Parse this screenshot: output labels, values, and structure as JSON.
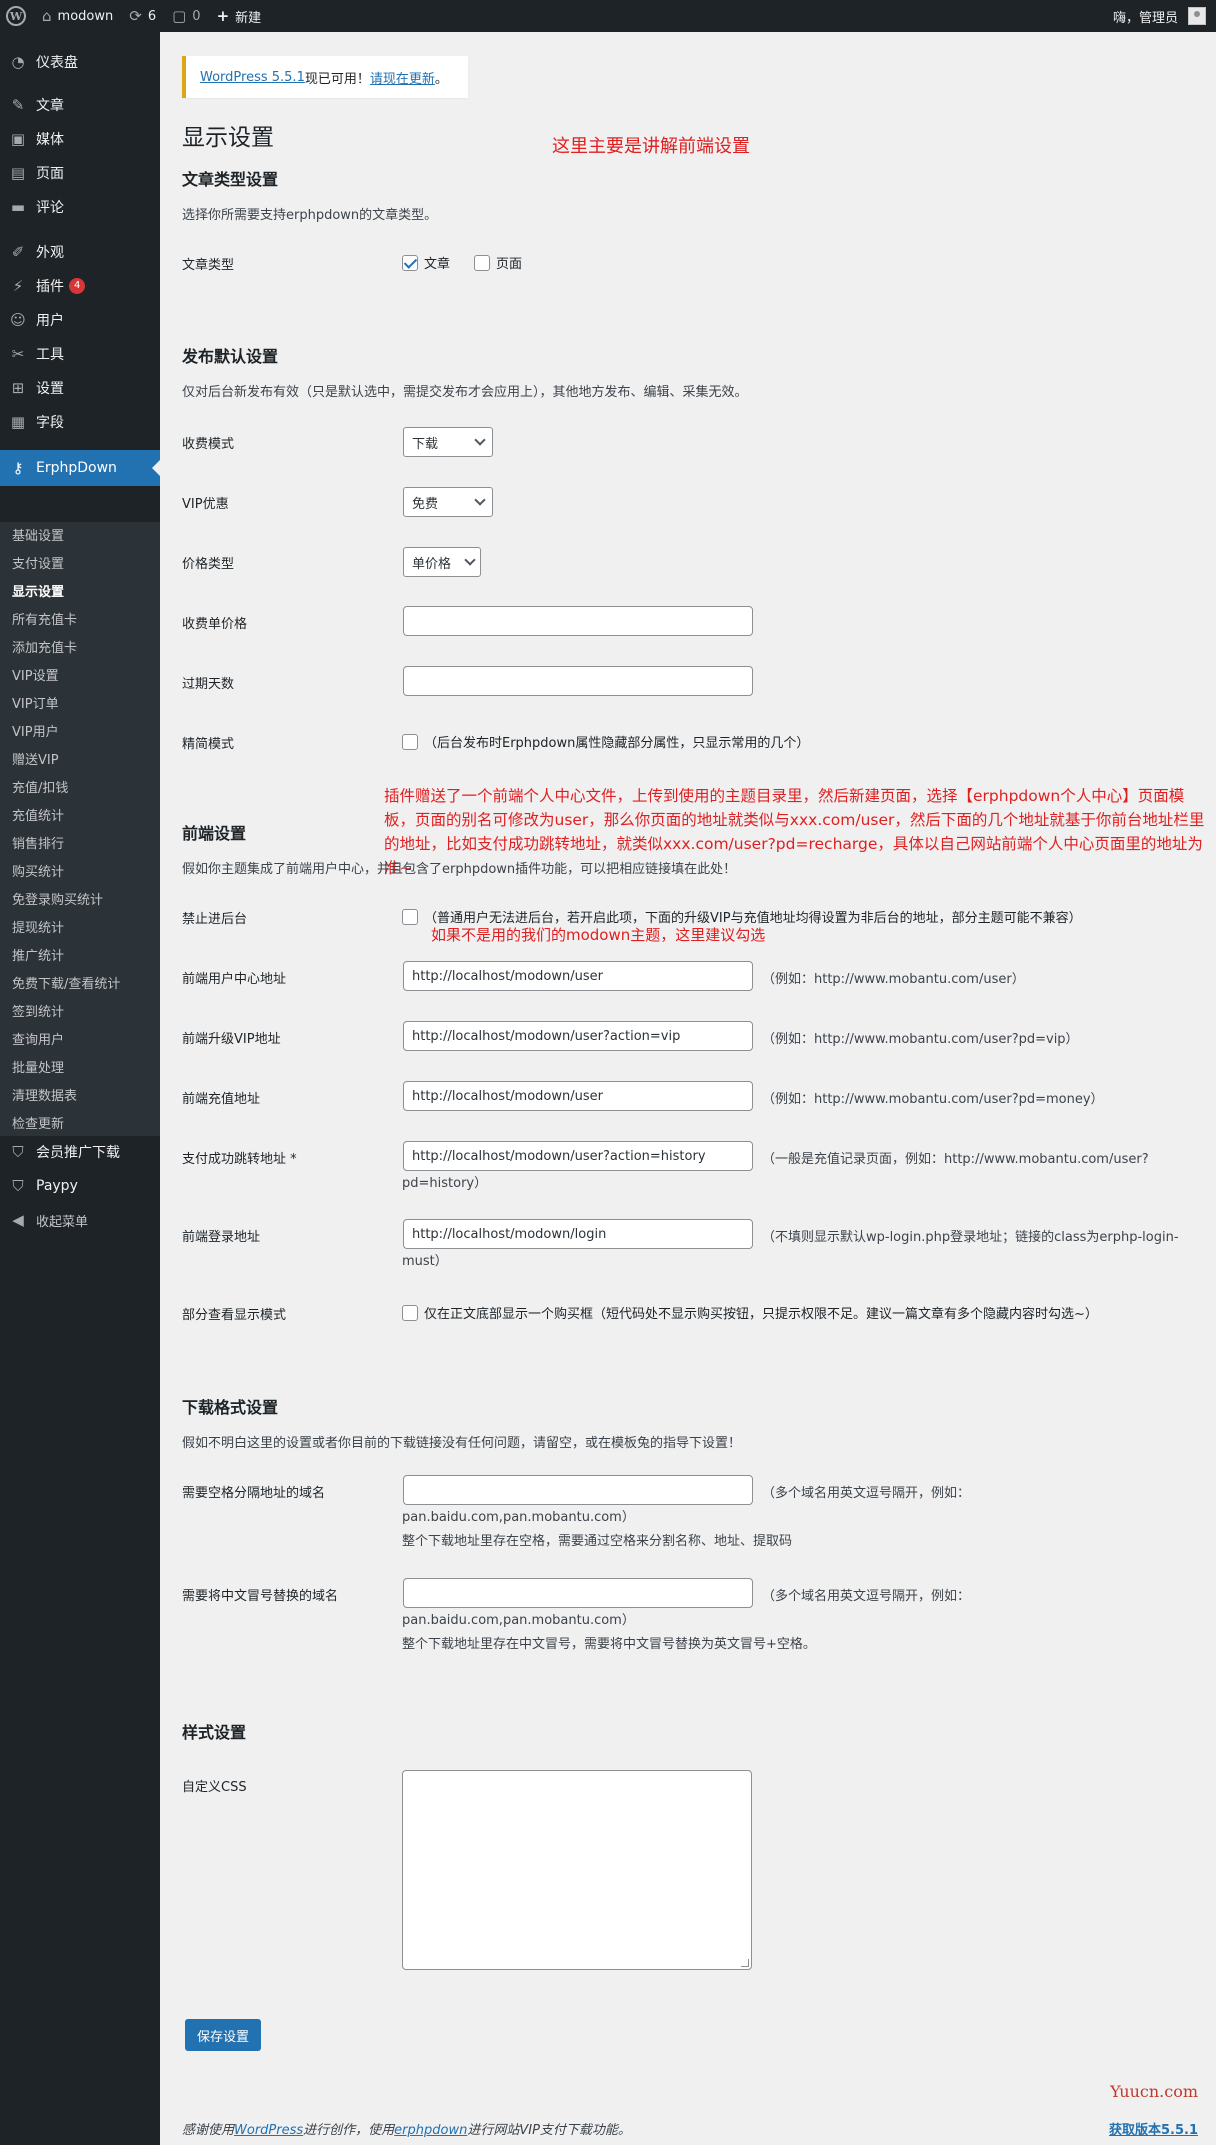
{
  "adminbar": {
    "site_name": "modown",
    "updates_count": "6",
    "comments_count": "0",
    "new_label": "新建",
    "greeting": "嗨，管理员"
  },
  "sidebar": {
    "top_items": [
      {
        "label": "仪表盘",
        "icon": "dashboard-icon"
      },
      {
        "label": "文章",
        "icon": "pin-icon"
      },
      {
        "label": "媒体",
        "icon": "media-icon"
      },
      {
        "label": "页面",
        "icon": "page-icon"
      },
      {
        "label": "评论",
        "icon": "comment-icon"
      },
      {
        "label": "外观",
        "icon": "brush-icon"
      },
      {
        "label": "插件",
        "icon": "plugin-icon",
        "badge": "4"
      },
      {
        "label": "用户",
        "icon": "user-icon"
      },
      {
        "label": "工具",
        "icon": "wrench-icon"
      },
      {
        "label": "设置",
        "icon": "settings-icon"
      },
      {
        "label": "字段",
        "icon": "table-icon"
      }
    ],
    "active_item": {
      "label": "ErphpDown",
      "icon": "key-icon"
    },
    "sub_items": [
      "基础设置",
      "支付设置",
      "显示设置",
      "所有充值卡",
      "添加充值卡",
      "VIP设置",
      "VIP订单",
      "VIP用户",
      "赠送VIP",
      "充值/扣钱",
      "充值统计",
      "销售排行",
      "购买统计",
      "免登录购买统计",
      "提现统计",
      "推广统计",
      "免费下载/查看统计",
      "签到统计",
      "查询用户",
      "批量处理",
      "清理数据表",
      "检查更新"
    ],
    "current_sub": "显示设置",
    "bottom_items": [
      {
        "label": "会员推广下载",
        "icon": "shield-icon"
      },
      {
        "label": "Paypy",
        "icon": "shield-icon"
      },
      {
        "label": "收起菜单",
        "icon": "collapse-icon"
      }
    ]
  },
  "notice": {
    "link_text": "WordPress 5.5.1",
    "middle": "现已可用！",
    "update_link": "请现在更新",
    "end": "。"
  },
  "page_title": "显示设置",
  "annotations": {
    "top": "这里主要是讲解前端设置",
    "plugin_note": "插件赠送了一个前端个人中心文件，上传到使用的主题目录里，然后新建页面，选择【erphpdown个人中心】页面模板，页面的别名可修改为user，那么你页面的地址就类似与xxx.com/user，然后下面的几个地址就基于你前台地址栏里的地址，比如支付成功跳转地址，就类似xxx.com/user?pd=recharge，具体以自己网站前端个人中心页面里的地址为准~",
    "backend_note": "如果不是用的我们的modown主题，这里建议勾选"
  },
  "post_type_section": {
    "title": "文章类型设置",
    "desc": "选择你所需要支持erphpdown的文章类型。",
    "label": "文章类型",
    "opt_post": "文章",
    "opt_page": "页面"
  },
  "publish_section": {
    "title": "发布默认设置",
    "desc": "仅对后台新发布有效（只是默认选中，需提交发布才会应用上），其他地方发布、编辑、采集无效。",
    "fee_mode_label": "收费模式",
    "fee_mode_value": "下载",
    "vip_label": "VIP优惠",
    "vip_value": "免费",
    "price_type_label": "价格类型",
    "price_type_value": "单价格",
    "unit_price_label": "收费单价格",
    "unit_price_value": "",
    "expire_label": "过期天数",
    "expire_value": "",
    "simple_label": "精简模式",
    "simple_desc": "（后台发布时Erphpdown属性隐藏部分属性，只显示常用的几个）"
  },
  "frontend_section": {
    "title": "前端设置",
    "desc": "假如你主题集成了前端用户中心，并且包含了erphpdown插件功能，可以把相应链接填在此处！",
    "no_backend_label": "禁止进后台",
    "no_backend_desc": "（普通用户无法进后台，若开启此项，下面的升级VIP与充值地址均得设置为非后台的地址，部分主题可能不兼容）",
    "user_center_label": "前端用户中心地址",
    "user_center_value": "http://localhost/modown/user",
    "user_center_hint": "（例如：http://www.mobantu.com/user）",
    "vip_upgrade_label": "前端升级VIP地址",
    "vip_upgrade_value": "http://localhost/modown/user?action=vip",
    "vip_upgrade_hint": "（例如：http://www.mobantu.com/user?pd=vip）",
    "recharge_label": "前端充值地址",
    "recharge_value": "http://localhost/modown/user",
    "recharge_hint": "（例如：http://www.mobantu.com/user?pd=money）",
    "success_label": "支付成功跳转地址 *",
    "success_value": "http://localhost/modown/user?action=history",
    "success_hint_1": "（一般是充值记录页面，例如：http://www.mobantu.com/user?",
    "success_hint_2": "pd=history）",
    "login_label": "前端登录地址",
    "login_value": "http://localhost/modown/login",
    "login_hint_1": "（不填则显示默认wp-login.php登录地址；链接的class为erphp-login-",
    "login_hint_2": "must）",
    "partial_label": "部分查看显示模式",
    "partial_desc": "仅在正文底部显示一个购买框（短代码处不显示购买按钮，只提示权限不足。建议一篇文章有多个隐藏内容时勾选~）"
  },
  "download_section": {
    "title": "下载格式设置",
    "desc": "假如不明白这里的设置或者你目前的下载链接没有任何问题，请留空，或在模板兔的指导下设置！",
    "space_label": "需要空格分隔地址的域名",
    "space_value": "",
    "space_hint_1": "（多个域名用英文逗号隔开，例如：",
    "space_hint_2": "pan.baidu.com,pan.mobantu.com）",
    "space_hint_3": "整个下载地址里存在空格，需要通过空格来分割名称、地址、提取码",
    "colon_label": "需要将中文冒号替换的域名",
    "colon_value": "",
    "colon_hint_1": "（多个域名用英文逗号隔开，例如：",
    "colon_hint_2": "pan.baidu.com,pan.mobantu.com）",
    "colon_hint_3": "整个下载地址里存在中文冒号，需要将中文冒号替换为英文冒号+空格。"
  },
  "style_section": {
    "title": "样式设置",
    "css_label": "自定义CSS"
  },
  "save_button": "保存设置",
  "footer": {
    "text_1": "感谢使用",
    "link_wp": "WordPress",
    "text_2": "进行创作，使用",
    "link_erphp": "erphpdown",
    "text_3": "进行网站VIP支付下载功能。",
    "version_link": "获取版本5.5.1"
  },
  "watermark": "Yuucn.com",
  "colors": {
    "admin_bg": "#1d2327",
    "accent": "#2271b1",
    "annotation": "#e02020",
    "notice_border": "#dba617"
  }
}
